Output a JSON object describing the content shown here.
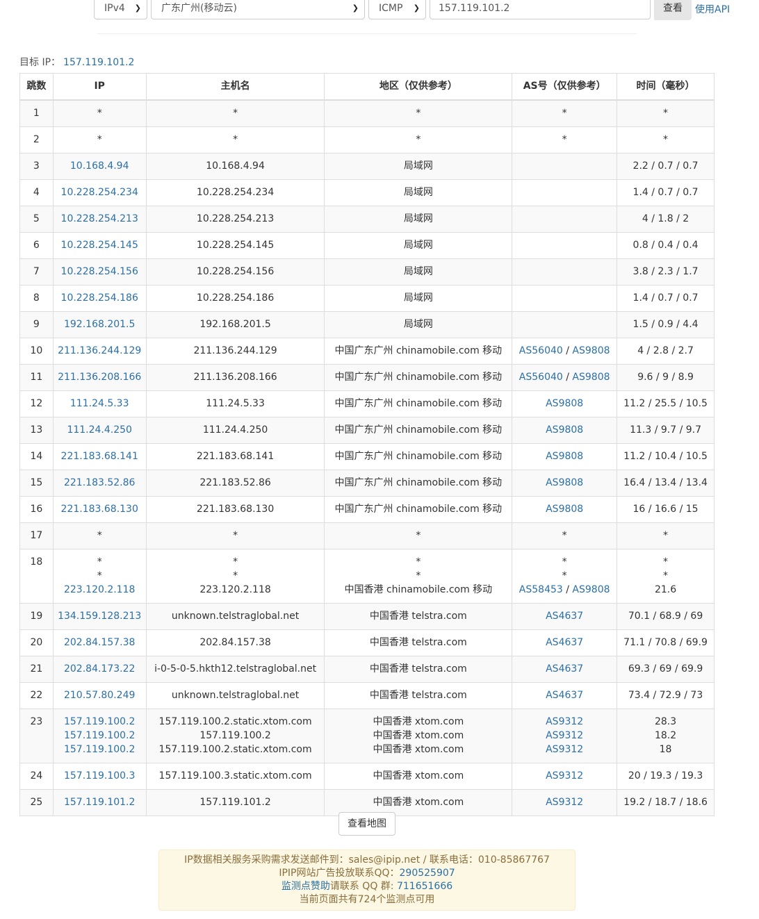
{
  "toolbar": {
    "protocol_version": "IPv4",
    "node": "广东广州(移动云)",
    "method": "ICMP",
    "target_input": "157.119.101.2",
    "query_button": "查看",
    "api_link": "使用API"
  },
  "target": {
    "label": "目标 IP：",
    "ip": "157.119.101.2"
  },
  "table": {
    "headers": [
      "跳数",
      "IP",
      "主机名",
      "地区（仅供参考）",
      "AS号（仅供参考）",
      "时间（毫秒）"
    ],
    "rows": [
      {
        "hop": "1",
        "ip": [
          "*"
        ],
        "host": [
          "*"
        ],
        "region": [
          "*"
        ],
        "as": [
          [
            "*"
          ]
        ],
        "time": [
          "*"
        ]
      },
      {
        "hop": "2",
        "ip": [
          "*"
        ],
        "host": [
          "*"
        ],
        "region": [
          "*"
        ],
        "as": [
          [
            "*"
          ]
        ],
        "time": [
          "*"
        ]
      },
      {
        "hop": "3",
        "ip": [
          "10.168.4.94"
        ],
        "host": [
          "10.168.4.94"
        ],
        "region": [
          "局域网"
        ],
        "as": [
          []
        ],
        "time": [
          "2.2 / 0.7 / 0.7"
        ]
      },
      {
        "hop": "4",
        "ip": [
          "10.228.254.234"
        ],
        "host": [
          "10.228.254.234"
        ],
        "region": [
          "局域网"
        ],
        "as": [
          []
        ],
        "time": [
          "1.4 / 0.7 / 0.7"
        ]
      },
      {
        "hop": "5",
        "ip": [
          "10.228.254.213"
        ],
        "host": [
          "10.228.254.213"
        ],
        "region": [
          "局域网"
        ],
        "as": [
          []
        ],
        "time": [
          "4 / 1.8 / 2"
        ]
      },
      {
        "hop": "6",
        "ip": [
          "10.228.254.145"
        ],
        "host": [
          "10.228.254.145"
        ],
        "region": [
          "局域网"
        ],
        "as": [
          []
        ],
        "time": [
          "0.8 / 0.4 / 0.4"
        ]
      },
      {
        "hop": "7",
        "ip": [
          "10.228.254.156"
        ],
        "host": [
          "10.228.254.156"
        ],
        "region": [
          "局域网"
        ],
        "as": [
          []
        ],
        "time": [
          "3.8 / 2.3 / 1.7"
        ]
      },
      {
        "hop": "8",
        "ip": [
          "10.228.254.186"
        ],
        "host": [
          "10.228.254.186"
        ],
        "region": [
          "局域网"
        ],
        "as": [
          []
        ],
        "time": [
          "1.4 / 0.7 / 0.7"
        ]
      },
      {
        "hop": "9",
        "ip": [
          "192.168.201.5"
        ],
        "host": [
          "192.168.201.5"
        ],
        "region": [
          "局域网"
        ],
        "as": [
          []
        ],
        "time": [
          "1.5 / 0.9 / 4.4"
        ]
      },
      {
        "hop": "10",
        "ip": [
          "211.136.244.129"
        ],
        "host": [
          "211.136.244.129"
        ],
        "region": [
          "中国广东广州 chinamobile.com 移动"
        ],
        "as": [
          [
            "AS56040",
            "AS9808"
          ]
        ],
        "time": [
          "4 / 2.8 / 2.7"
        ]
      },
      {
        "hop": "11",
        "ip": [
          "211.136.208.166"
        ],
        "host": [
          "211.136.208.166"
        ],
        "region": [
          "中国广东广州 chinamobile.com 移动"
        ],
        "as": [
          [
            "AS56040",
            "AS9808"
          ]
        ],
        "time": [
          "9.6 / 9 / 8.9"
        ]
      },
      {
        "hop": "12",
        "ip": [
          "111.24.5.33"
        ],
        "host": [
          "111.24.5.33"
        ],
        "region": [
          "中国广东广州 chinamobile.com 移动"
        ],
        "as": [
          [
            "AS9808"
          ]
        ],
        "time": [
          "11.2 / 25.5 / 10.5"
        ]
      },
      {
        "hop": "13",
        "ip": [
          "111.24.4.250"
        ],
        "host": [
          "111.24.4.250"
        ],
        "region": [
          "中国广东广州 chinamobile.com 移动"
        ],
        "as": [
          [
            "AS9808"
          ]
        ],
        "time": [
          "11.3 / 9.7 / 9.7"
        ]
      },
      {
        "hop": "14",
        "ip": [
          "221.183.68.141"
        ],
        "host": [
          "221.183.68.141"
        ],
        "region": [
          "中国广东广州 chinamobile.com 移动"
        ],
        "as": [
          [
            "AS9808"
          ]
        ],
        "time": [
          "11.2 / 10.4 / 10.5"
        ]
      },
      {
        "hop": "15",
        "ip": [
          "221.183.52.86"
        ],
        "host": [
          "221.183.52.86"
        ],
        "region": [
          "中国广东广州 chinamobile.com 移动"
        ],
        "as": [
          [
            "AS9808"
          ]
        ],
        "time": [
          "16.4 / 13.4 / 13.4"
        ]
      },
      {
        "hop": "16",
        "ip": [
          "221.183.68.130"
        ],
        "host": [
          "221.183.68.130"
        ],
        "region": [
          "中国广东广州 chinamobile.com 移动"
        ],
        "as": [
          [
            "AS9808"
          ]
        ],
        "time": [
          "16 / 16.6 / 15"
        ]
      },
      {
        "hop": "17",
        "ip": [
          "*"
        ],
        "host": [
          "*"
        ],
        "region": [
          "*"
        ],
        "as": [
          [
            "*"
          ]
        ],
        "time": [
          "*"
        ]
      },
      {
        "hop": "18",
        "ip": [
          "*",
          "*",
          "223.120.2.118"
        ],
        "host": [
          "*",
          "*",
          "223.120.2.118"
        ],
        "region": [
          "*",
          "*",
          "中国香港 chinamobile.com 移动"
        ],
        "as": [
          [
            "*"
          ],
          [
            "*"
          ],
          [
            "AS58453",
            "AS9808"
          ]
        ],
        "time": [
          "*",
          "*",
          "21.6"
        ]
      },
      {
        "hop": "19",
        "ip": [
          "134.159.128.213"
        ],
        "host": [
          "unknown.telstraglobal.net"
        ],
        "region": [
          "中国香港 telstra.com"
        ],
        "as": [
          [
            "AS4637"
          ]
        ],
        "time": [
          "70.1 / 68.9 / 69"
        ]
      },
      {
        "hop": "20",
        "ip": [
          "202.84.157.38"
        ],
        "host": [
          "202.84.157.38"
        ],
        "region": [
          "中国香港 telstra.com"
        ],
        "as": [
          [
            "AS4637"
          ]
        ],
        "time": [
          "71.1 / 70.8 / 69.9"
        ]
      },
      {
        "hop": "21",
        "ip": [
          "202.84.173.22"
        ],
        "host": [
          "i-0-5-0-5.hkth12.telstraglobal.net"
        ],
        "region": [
          "中国香港 telstra.com"
        ],
        "as": [
          [
            "AS4637"
          ]
        ],
        "time": [
          "69.3 / 69 / 69.9"
        ]
      },
      {
        "hop": "22",
        "ip": [
          "210.57.80.249"
        ],
        "host": [
          "unknown.telstraglobal.net"
        ],
        "region": [
          "中国香港 telstra.com"
        ],
        "as": [
          [
            "AS4637"
          ]
        ],
        "time": [
          "73.4 / 72.9 / 73"
        ]
      },
      {
        "hop": "23",
        "ip": [
          "157.119.100.2",
          "157.119.100.2",
          "157.119.100.2"
        ],
        "host": [
          "157.119.100.2.static.xtom.com",
          "157.119.100.2",
          "157.119.100.2.static.xtom.com"
        ],
        "region": [
          "中国香港 xtom.com",
          "中国香港 xtom.com",
          "中国香港 xtom.com"
        ],
        "as": [
          [
            "AS9312"
          ],
          [
            "AS9312"
          ],
          [
            "AS9312"
          ]
        ],
        "time": [
          "28.3",
          "18.2",
          "18"
        ]
      },
      {
        "hop": "24",
        "ip": [
          "157.119.100.3"
        ],
        "host": [
          "157.119.100.3.static.xtom.com"
        ],
        "region": [
          "中国香港 xtom.com"
        ],
        "as": [
          [
            "AS9312"
          ]
        ],
        "time": [
          "20 / 19.3 / 19.3"
        ]
      },
      {
        "hop": "25",
        "ip": [
          "157.119.101.2"
        ],
        "host": [
          "157.119.101.2"
        ],
        "region": [
          "中国香港 xtom.com"
        ],
        "as": [
          [
            "AS9312"
          ]
        ],
        "time": [
          "19.2 / 18.7 / 18.6"
        ]
      }
    ]
  },
  "map_button": "查看地图",
  "notice": {
    "line1": "IP数据相关服务采购需求发送邮件到：sales@ipip.net / 联系电话：010-85867767",
    "line2_prefix": "IPIP网站广告投放联系QQ：",
    "line2_qq": "290525907",
    "line3_link": "监测点赞助",
    "line3_middle": "请联系 QQ 群: ",
    "line3_group": "711651666",
    "line4": "当前页面共有724个监测点可用"
  }
}
